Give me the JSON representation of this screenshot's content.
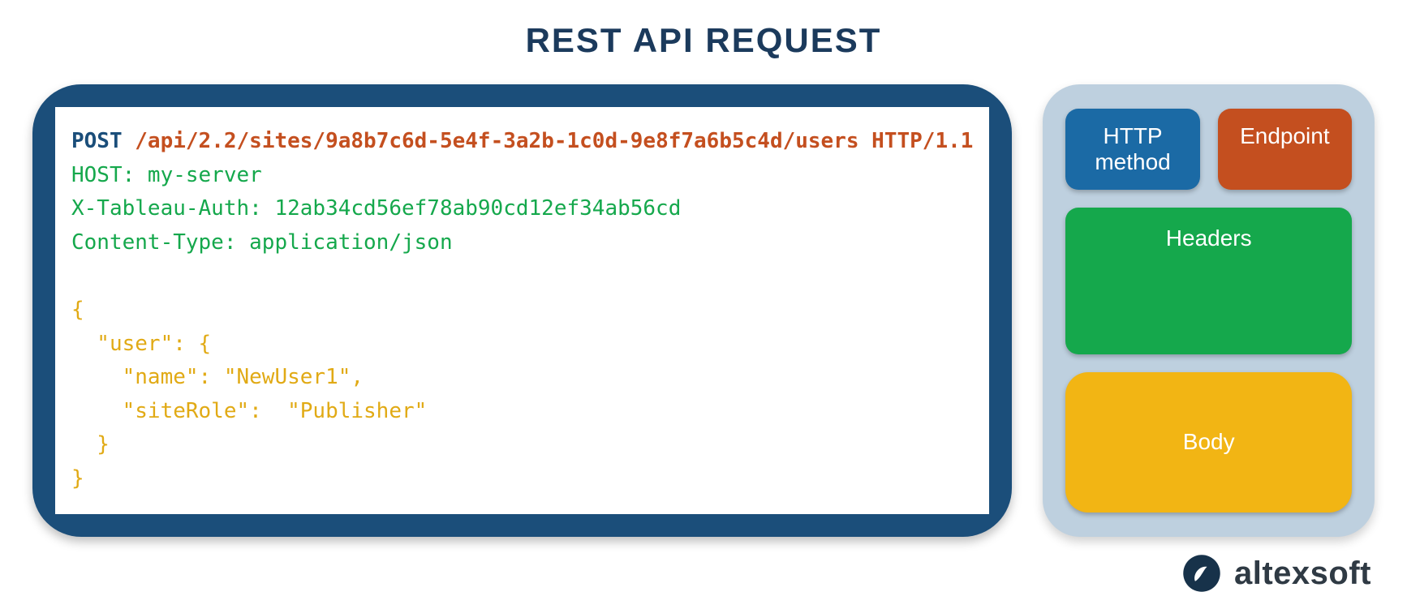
{
  "title": "REST API REQUEST",
  "code": {
    "method": "POST",
    "endpoint": "/api/2.2/sites/9a8b7c6d-5e4f-3a2b-1c0d-9e8f7a6b5c4d/users HTTP/1.1",
    "header1": "HOST: my-server",
    "header2": "X-Tableau-Auth: 12ab34cd56ef78ab90cd12ef34ab56cd",
    "header3": "Content-Type: application/json",
    "body_l1": "{",
    "body_l2": "  \"user\": {",
    "body_l3": "    \"name\": \"NewUser1\",",
    "body_l4": "    \"siteRole\":  \"Publisher\"",
    "body_l5": "  }",
    "body_l6": "}"
  },
  "legend": {
    "method": "HTTP method",
    "endpoint": "Endpoint",
    "headers": "Headers",
    "body": "Body"
  },
  "brand": "altexsoft",
  "colors": {
    "method": "#1b6aa5",
    "endpoint": "#c44f1f",
    "headers": "#15a84c",
    "body": "#f2b514",
    "card": "#1b4e7a",
    "legend_bg": "#bed0df"
  }
}
